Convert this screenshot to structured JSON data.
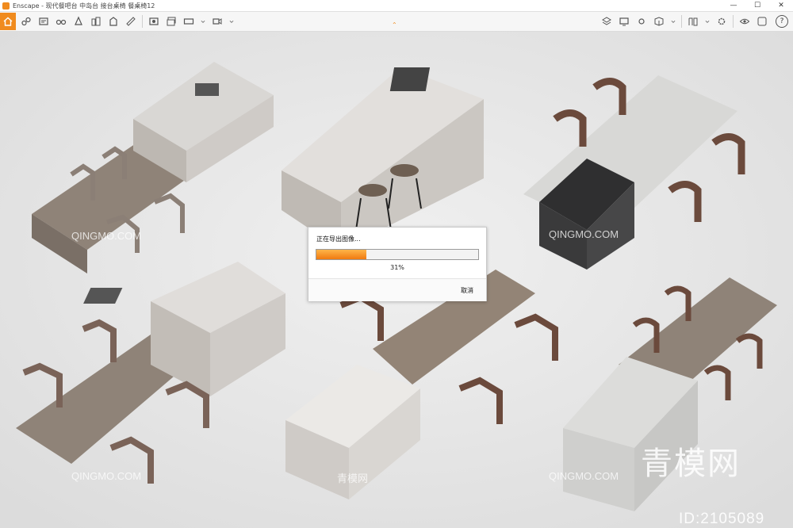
{
  "window": {
    "title": "Enscape - 现代餐吧台 中岛台 接台桌椅 餐桌椅12"
  },
  "toolbar": {
    "left_icons": [
      "home-icon",
      "link-icon",
      "bim-icon",
      "binoculars-icon",
      "orbit-icon",
      "asset-library-icon",
      "building-icon",
      "ruler-icon",
      "dropdown-icon",
      "screenshot-icon",
      "batch-render-icon",
      "panorama-icon",
      "dropdown-icon",
      "video-icon",
      "dropdown-icon"
    ],
    "right_icons": [
      "layers-icon",
      "display-icon",
      "sun-icon",
      "cube-icon",
      "dropdown-icon",
      "book-icon",
      "dropdown-icon",
      "settings-icon",
      "eye-icon",
      "capture-icon"
    ],
    "help_label": "?"
  },
  "dialog": {
    "title": "正在导出图像...",
    "progress_fraction": 0.31,
    "percent_text": "31%",
    "cancel_label": "取消"
  },
  "watermarks": {
    "big": "青模网",
    "id": "ID:2105089",
    "latin": "QINGMO.COM",
    "cn": "青模网"
  },
  "colors": {
    "accent": "#f08b1e",
    "progress_start": "#ffb54a",
    "progress_end": "#f07a10"
  }
}
